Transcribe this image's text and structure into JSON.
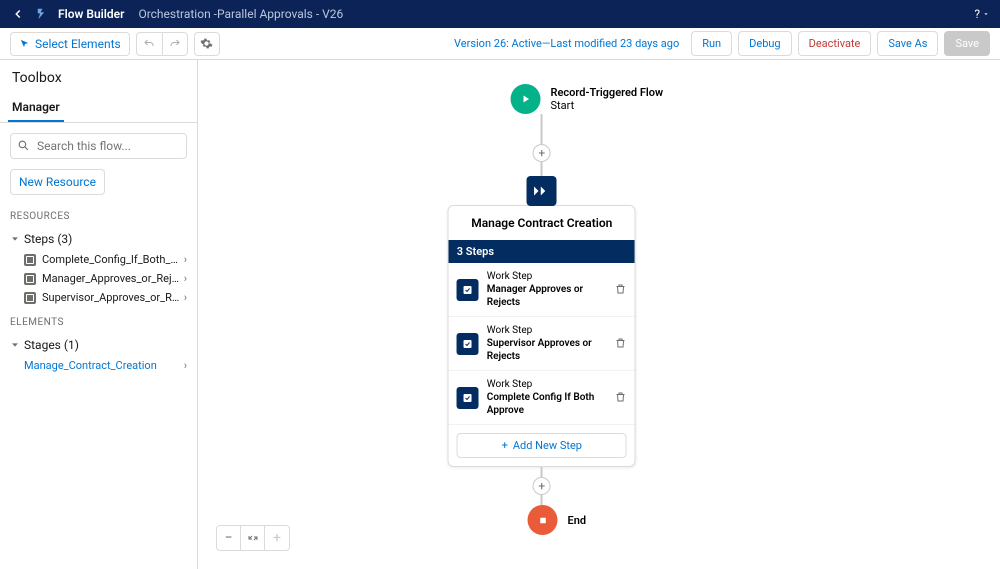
{
  "header": {
    "app_name": "Flow Builder",
    "flow_name": "Orchestration -Parallel Approvals - V26",
    "help_label": "?"
  },
  "toolbar": {
    "select_elements": "Select Elements",
    "version_text": "Version 26: Active—Last modified 23 days ago",
    "run": "Run",
    "debug": "Debug",
    "deactivate": "Deactivate",
    "save_as": "Save As",
    "save": "Save"
  },
  "sidebar": {
    "title": "Toolbox",
    "tab": "Manager",
    "search_placeholder": "Search this flow...",
    "new_resource": "New Resource",
    "resources_hdr": "RESOURCES",
    "steps_label": "Steps (3)",
    "steps": [
      "Complete_Config_If_Both_Approve",
      "Manager_Approves_or_Rejects",
      "Supervisor_Approves_or_Rejects"
    ],
    "elements_hdr": "ELEMENTS",
    "stages_label": "Stages (1)",
    "stages": [
      "Manage_Contract_Creation"
    ]
  },
  "canvas": {
    "start_type": "Record-Triggered Flow",
    "start_label": "Start",
    "stage_title": "Manage Contract Creation",
    "stage_bar": "3 Steps",
    "work_step": "Work Step",
    "steps": [
      "Manager Approves or Rejects",
      "Supervisor Approves or Rejects",
      "Complete Config If Both Approve"
    ],
    "add_step": "Add New Step",
    "end_label": "End"
  }
}
